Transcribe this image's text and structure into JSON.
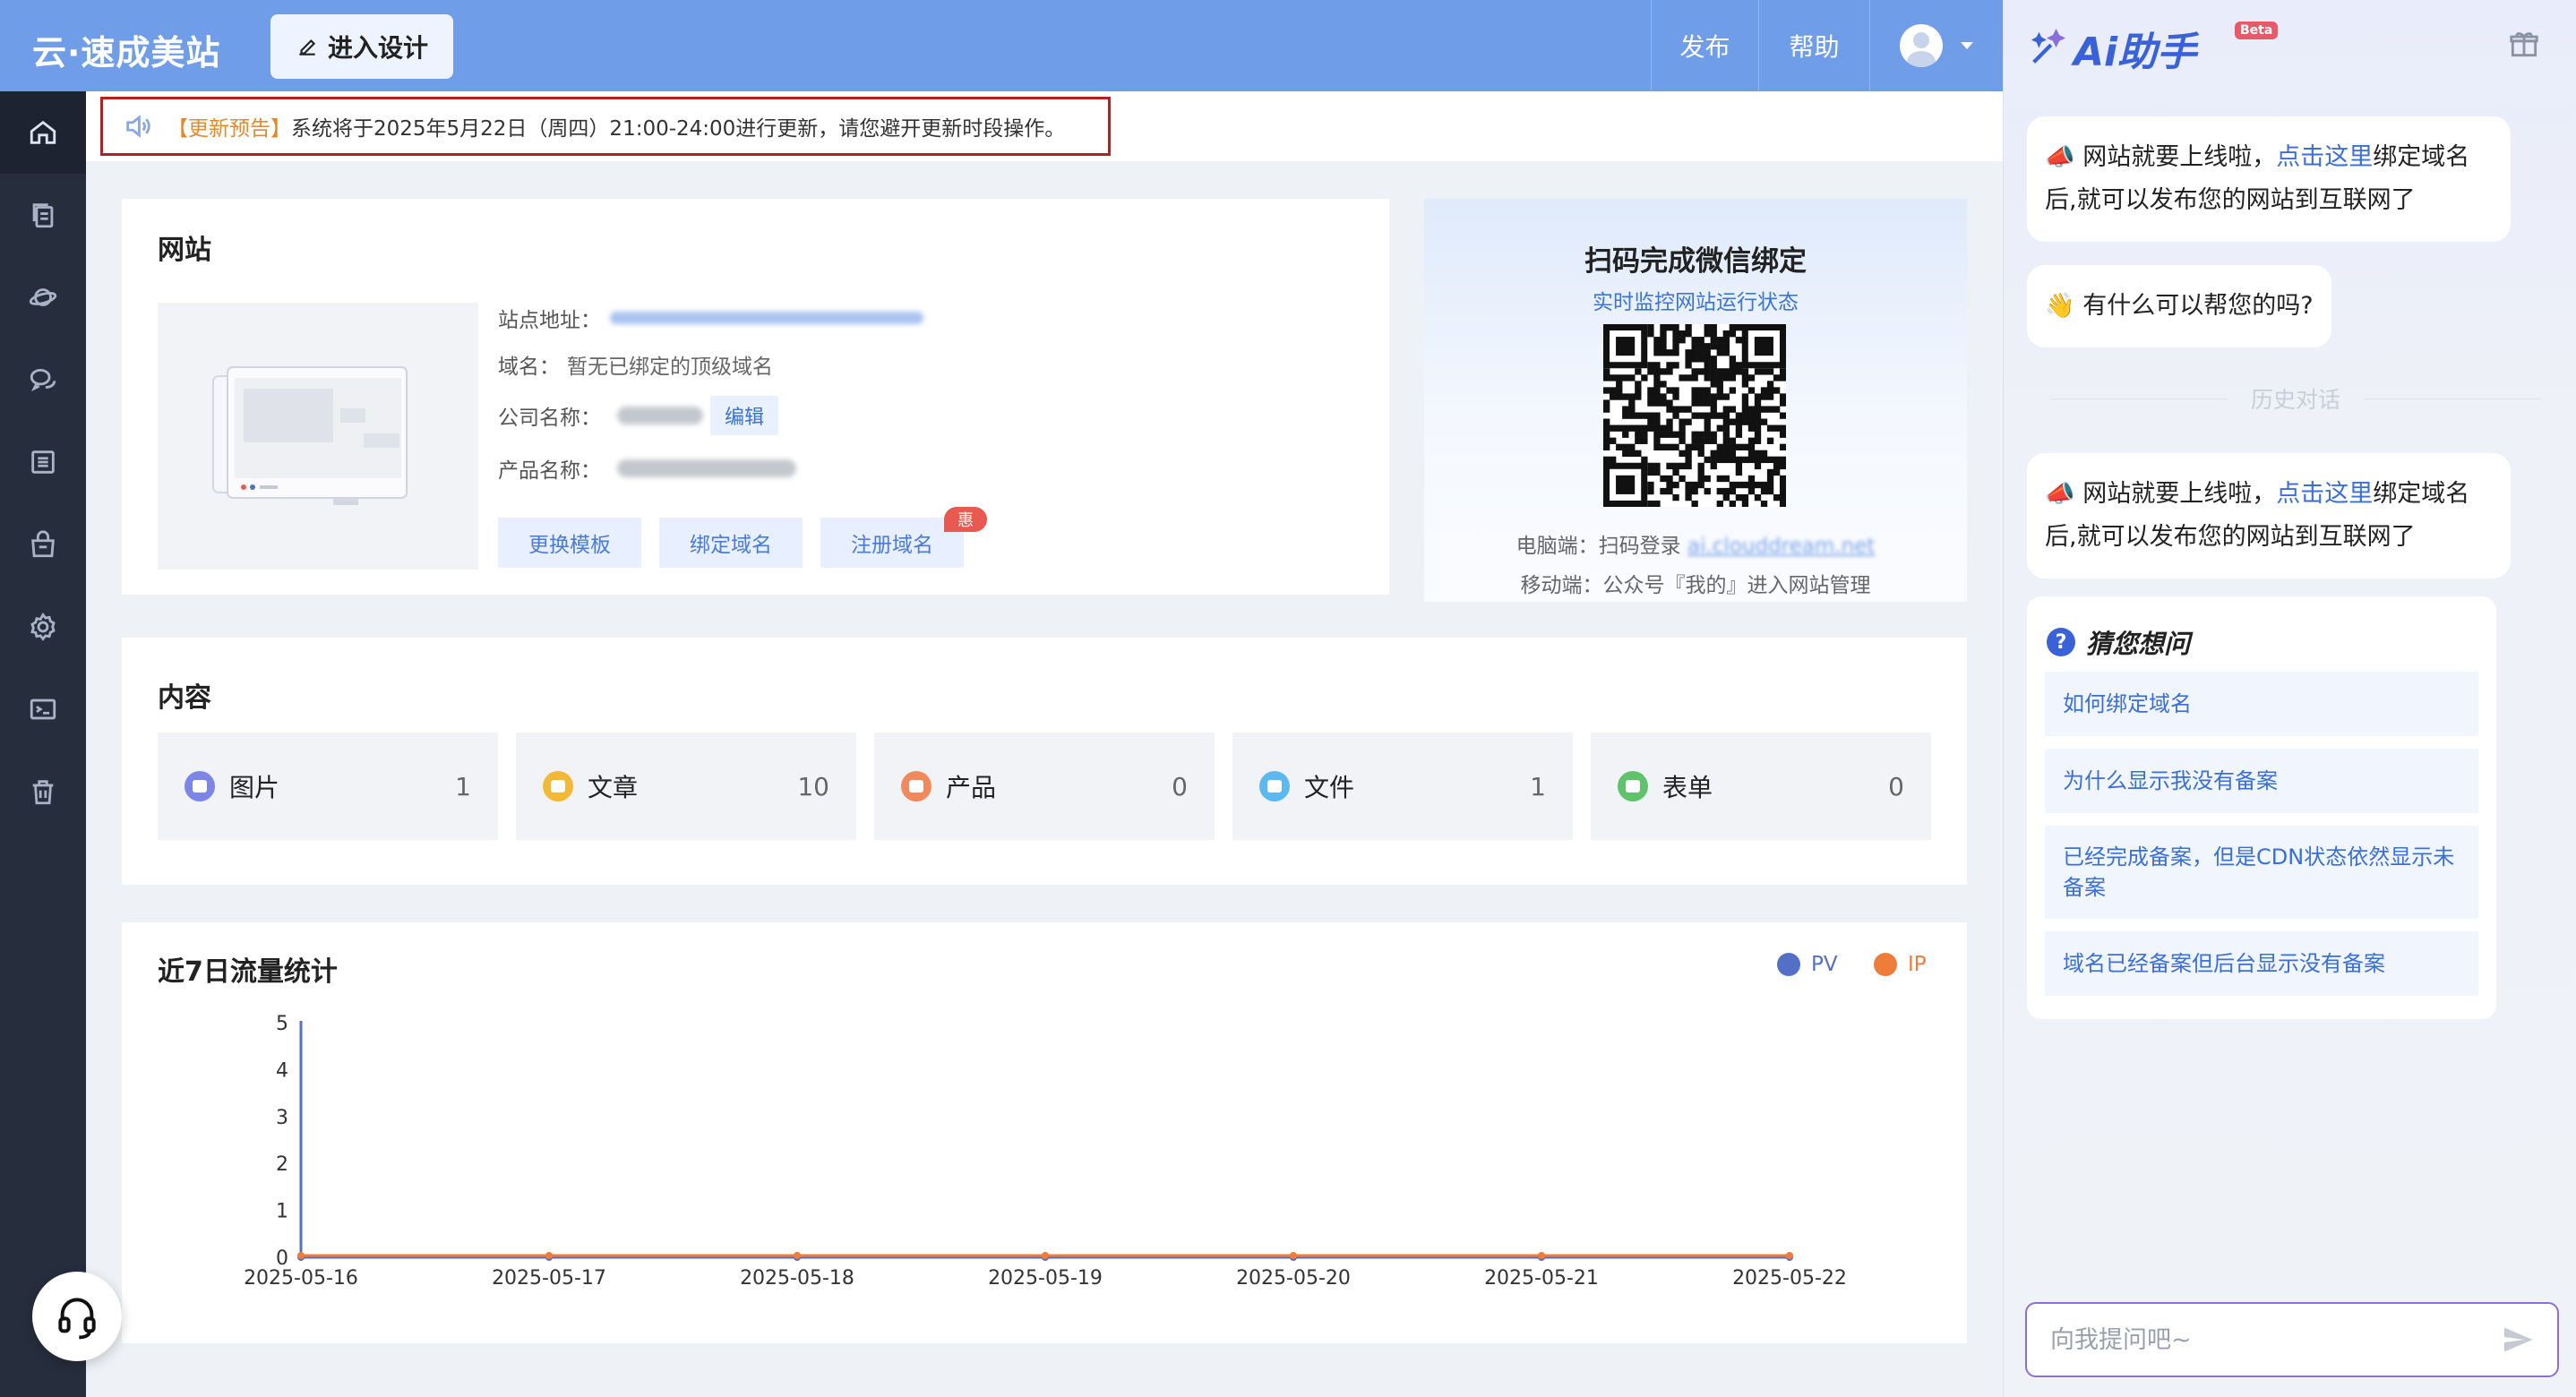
{
  "header": {
    "logo": "云·速成美站",
    "design_button": "进入设计",
    "publish": "发布",
    "help": "帮助"
  },
  "sidebar": {
    "items": [
      "home-icon",
      "pages-icon",
      "planet-icon",
      "chat-icon",
      "list-icon",
      "shop-icon",
      "gear-icon",
      "terminal-icon",
      "trash-icon"
    ]
  },
  "notice": {
    "tag": "【更新预告】",
    "text": "系统将于2025年5月22日（周四）21:00-24:00进行更新，请您避开更新时段操作。"
  },
  "site": {
    "title": "网站",
    "address_label": "站点地址：",
    "domain_label": "域名：",
    "domain_value": "暂无已绑定的顶级域名",
    "company_label": "公司名称：",
    "edit": "编辑",
    "product_label": "产品名称：",
    "btn_template": "更换模板",
    "btn_bind": "绑定域名",
    "btn_register": "注册域名",
    "badge": "惠"
  },
  "qr": {
    "title": "扫码完成微信绑定",
    "subtitle": "实时监控网站运行状态",
    "pc_label": "电脑端：扫码登录",
    "pc_link": "ai.clouddream.net",
    "mobile": "移动端：公众号『我的』进入网站管理"
  },
  "content": {
    "title": "内容",
    "items": [
      {
        "label": "图片",
        "value": "1",
        "color": "#7b86e6"
      },
      {
        "label": "文章",
        "value": "10",
        "color": "#f3b836"
      },
      {
        "label": "产品",
        "value": "0",
        "color": "#f08a5d"
      },
      {
        "label": "文件",
        "value": "1",
        "color": "#5cb8f0"
      },
      {
        "label": "表单",
        "value": "0",
        "color": "#5ec36b"
      }
    ]
  },
  "traffic": {
    "title": "近7日流量统计"
  },
  "chart_data": {
    "type": "line",
    "x": [
      "2025-05-16",
      "2025-05-17",
      "2025-05-18",
      "2025-05-19",
      "2025-05-20",
      "2025-05-21",
      "2025-05-22"
    ],
    "series": [
      {
        "name": "PV",
        "values": [
          0,
          0,
          0,
          0,
          0,
          0,
          0
        ],
        "color": "#5470c6"
      },
      {
        "name": "IP",
        "values": [
          0,
          0,
          0,
          0,
          0,
          0,
          0
        ],
        "color": "#ee7d3a"
      }
    ],
    "yticks": [
      0,
      1,
      2,
      3,
      4,
      5
    ],
    "ylim": [
      0,
      5
    ],
    "legend": "top-right",
    "grid": false
  },
  "ai": {
    "title": "Ai助手",
    "beta": "Beta",
    "msg1_pre": "网站就要上线啦，",
    "msg1_link": "点击这里",
    "msg1_post": "绑定域名后,就可以发布您的网站到互联网了",
    "msg2": "有什么可以帮您的吗?",
    "history_divider": "历史对话",
    "guess_title": "猜您想问",
    "guess": [
      "如何绑定域名",
      "为什么显示我没有备案",
      "已经完成备案，但是CDN状态依然显示未备案",
      "域名已经备案但后台显示没有备案"
    ],
    "input_placeholder": "向我提问吧~"
  }
}
